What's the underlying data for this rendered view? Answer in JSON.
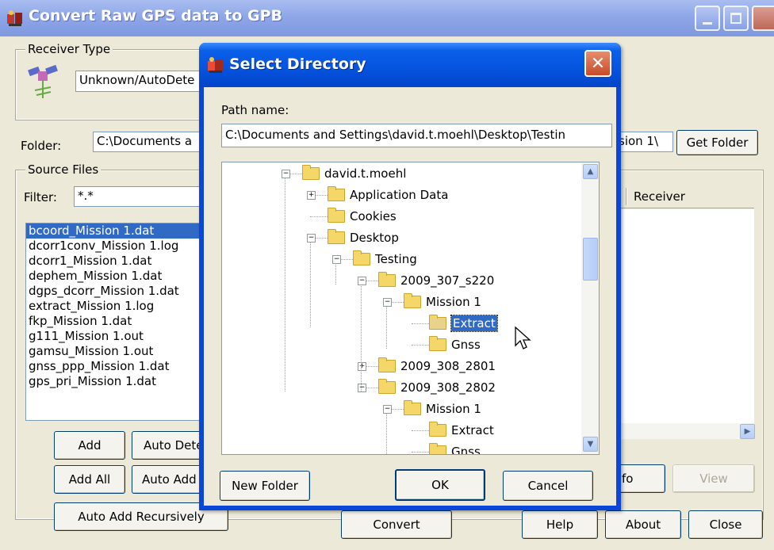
{
  "window": {
    "title": "Convert Raw GPS data to GPB",
    "receiver_type_label": "Receiver Type",
    "receiver_value": "Unknown/AutoDete",
    "folder_label": "Folder:",
    "folder_value": "C:\\Documents a",
    "folder_suffix": "sion 1\\",
    "get_folder": "Get Folder",
    "source_files_label": "Source Files",
    "filter_label": "Filter:",
    "filter_value": "*.*",
    "files": [
      "bcoord_Mission 1.dat",
      "dcorr1conv_Mission 1.log",
      "dcorr1_Mission 1.dat",
      "dephem_Mission 1.dat",
      "dgps_dcorr_Mission 1.dat",
      "extract_Mission 1.log",
      "fkp_Mission 1.dat",
      "g111_Mission 1.out",
      "gamsu_Mission 1.out",
      "gnss_ppp_Mission 1.dat",
      "gps_pri_Mission 1.dat"
    ],
    "receiver_col": "Receiver",
    "buttons": {
      "add": "Add",
      "auto_detect": "Auto Dete",
      "add_all": "Add All",
      "auto_add": "Auto Add",
      "auto_add_recursively": "Auto Add Recursively",
      "convert": "Convert",
      "info": "fo",
      "view": "View",
      "help": "Help",
      "about": "About",
      "close": "Close"
    }
  },
  "dialog": {
    "title": "Select Directory",
    "path_label": "Path name:",
    "path_value": "C:\\Documents and Settings\\david.t.moehl\\Desktop\\Testin",
    "tree": [
      {
        "label": "david.t.moehl",
        "depth": 0,
        "expander": "-"
      },
      {
        "label": "Application Data",
        "depth": 1,
        "expander": "+"
      },
      {
        "label": "Cookies",
        "depth": 1,
        "expander": ""
      },
      {
        "label": "Desktop",
        "depth": 1,
        "expander": "-"
      },
      {
        "label": "Testing",
        "depth": 2,
        "expander": "-"
      },
      {
        "label": "2009_307_s220",
        "depth": 3,
        "expander": "-"
      },
      {
        "label": "Mission 1",
        "depth": 4,
        "expander": "-"
      },
      {
        "label": "Extract",
        "depth": 5,
        "expander": "",
        "selected": true
      },
      {
        "label": "Gnss",
        "depth": 5,
        "expander": ""
      },
      {
        "label": "2009_308_2801",
        "depth": 3,
        "expander": "+"
      },
      {
        "label": "2009_308_2802",
        "depth": 3,
        "expander": "-"
      },
      {
        "label": "Mission 1",
        "depth": 4,
        "expander": "-"
      },
      {
        "label": "Extract",
        "depth": 5,
        "expander": ""
      },
      {
        "label": "Gnss",
        "depth": 5,
        "expander": ""
      }
    ],
    "buttons": {
      "new_folder": "New Folder",
      "ok": "OK",
      "cancel": "Cancel"
    }
  },
  "icons": {
    "app": "app-icon",
    "receiver": "satellite-icon",
    "close": "close-icon"
  }
}
